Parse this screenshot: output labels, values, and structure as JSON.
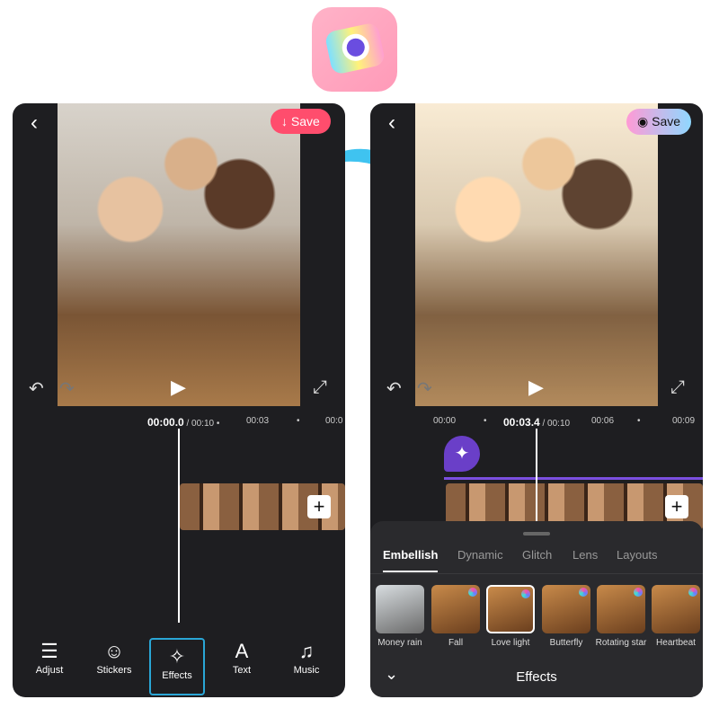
{
  "app_logo": "camera-app-logo",
  "before": {
    "save_label": "Save",
    "save_color": "#ff4d6d",
    "timeline": {
      "current": "00:00.0",
      "total": "/ 00:10",
      "ticks": [
        "00:03",
        "00:0"
      ]
    },
    "toolbar": [
      {
        "label": "Adjust",
        "icon": "sliders-icon"
      },
      {
        "label": "Stickers",
        "icon": "sticker-icon"
      },
      {
        "label": "Effects",
        "icon": "sparkles-icon",
        "selected": true
      },
      {
        "label": "Text",
        "icon": "text-icon"
      },
      {
        "label": "Music",
        "icon": "music-icon"
      }
    ]
  },
  "after": {
    "save_label": "Save",
    "timeline": {
      "ticks": [
        "00:00",
        "00:06",
        "00:09"
      ],
      "current": "00:03.4",
      "total": "/ 00:10"
    },
    "tabs": [
      "Embellish",
      "Dynamic",
      "Glitch",
      "Lens",
      "Layouts"
    ],
    "active_tab": "Embellish",
    "effects": [
      {
        "label": "Money rain"
      },
      {
        "label": "Fall"
      },
      {
        "label": "Love light",
        "selected": true
      },
      {
        "label": "Butterfly"
      },
      {
        "label": "Rotating star"
      },
      {
        "label": "Heartbeat"
      }
    ],
    "panel_title": "Effects"
  }
}
